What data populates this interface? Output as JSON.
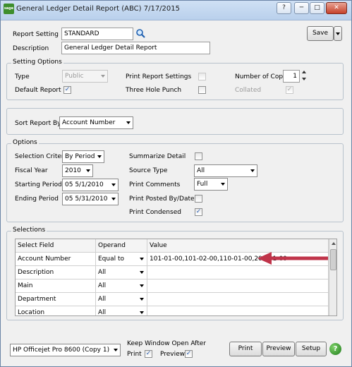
{
  "window": {
    "app_icon_text": "sage",
    "title": "General Ledger Detail Report (ABC) 7/17/2015",
    "controls": [
      "?",
      "─",
      "□",
      "✕"
    ]
  },
  "report": {
    "setting_label": "Report Setting",
    "setting_value": "STANDARD",
    "description_label": "Description",
    "description_value": "General Ledger Detail Report",
    "save_label": "Save"
  },
  "setting_options": {
    "group_label": "Setting Options",
    "type_label": "Type",
    "type_value": "Public",
    "print_report_settings_label": "Print Report Settings",
    "number_of_copies_label": "Number of Copies",
    "number_of_copies_value": "1",
    "default_report_label": "Default Report",
    "three_hole_punch_label": "Three Hole Punch",
    "collated_label": "Collated"
  },
  "sort": {
    "label": "Sort Report By",
    "value": "Account Number"
  },
  "options": {
    "group_label": "Options",
    "selection_criteria_label": "Selection Criteria",
    "selection_criteria_value": "By Period",
    "fiscal_year_label": "Fiscal Year",
    "fiscal_year_value": "2010",
    "starting_period_label": "Starting Period",
    "starting_period_value": "05 5/1/2010",
    "ending_period_label": "Ending Period",
    "ending_period_value": "05 5/31/2010",
    "summarize_detail_label": "Summarize Detail",
    "source_type_label": "Source Type",
    "source_type_value": "All",
    "print_comments_label": "Print Comments",
    "print_comments_value": "Full",
    "print_posted_by_label": "Print Posted By/Date",
    "print_condensed_label": "Print Condensed"
  },
  "selections": {
    "group_label": "Selections",
    "headers": [
      "Select Field",
      "Operand",
      "Value"
    ],
    "rows": [
      {
        "field": "Account Number",
        "operand": "Equal to",
        "value": "101-01-00,101-02-00,110-01-00,200-01-00"
      },
      {
        "field": "Description",
        "operand": "All",
        "value": ""
      },
      {
        "field": "Main",
        "operand": "All",
        "value": ""
      },
      {
        "field": "Department",
        "operand": "All",
        "value": ""
      },
      {
        "field": "Location",
        "operand": "All",
        "value": ""
      }
    ],
    "arrow_color": "#c0344a"
  },
  "footer": {
    "printer_value": "HP Officejet Pro 8600 (Copy 1)",
    "keep_open_label": "Keep Window Open After",
    "print_label": "Print",
    "preview_label": "Preview",
    "print_button": "Print",
    "preview_button": "Preview",
    "setup_button": "Setup",
    "help_symbol": "?"
  }
}
